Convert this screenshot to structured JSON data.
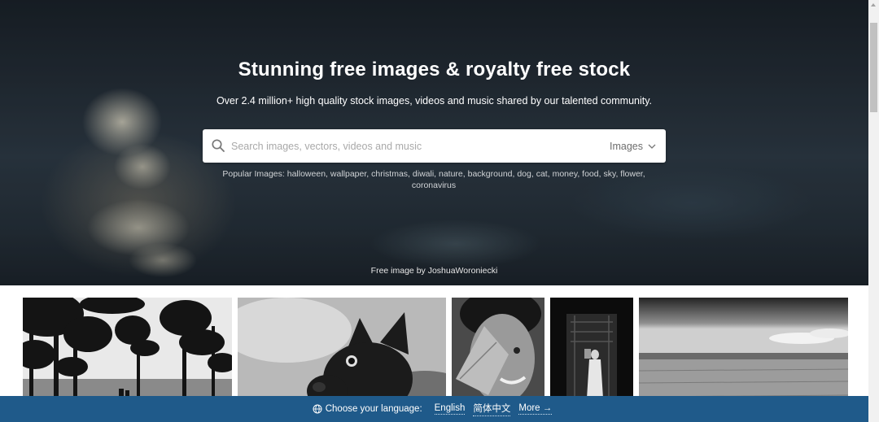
{
  "hero": {
    "title": "Stunning free images & royalty free stock",
    "subtitle": "Over 2.4 million+ high quality stock images, videos and music shared by our talented community.",
    "credit": "Free image by JoshuaWoroniecki"
  },
  "search": {
    "placeholder": "Search images, vectors, videos and music",
    "value": "",
    "type_selected": "Images"
  },
  "popular": {
    "label": "Popular Images:",
    "tags": [
      "halloween",
      "wallpaper",
      "christmas",
      "diwali",
      "nature",
      "background",
      "dog",
      "cat",
      "money",
      "food",
      "sky",
      "flower",
      "coronavirus"
    ]
  },
  "gallery": {
    "items": [
      {
        "subject": "trees-silhouette"
      },
      {
        "subject": "french-bulldog"
      },
      {
        "subject": "child-with-leaf"
      },
      {
        "subject": "woman-in-doorway"
      },
      {
        "subject": "field-landscape"
      }
    ]
  },
  "language_bar": {
    "label": "Choose your language:",
    "languages": [
      "English",
      "简体中文"
    ],
    "more": "More →",
    "background": "#1f5a8a"
  },
  "icons": {
    "search": "search-icon",
    "dropdown": "chevron-down-icon",
    "language": "globe-icon"
  }
}
